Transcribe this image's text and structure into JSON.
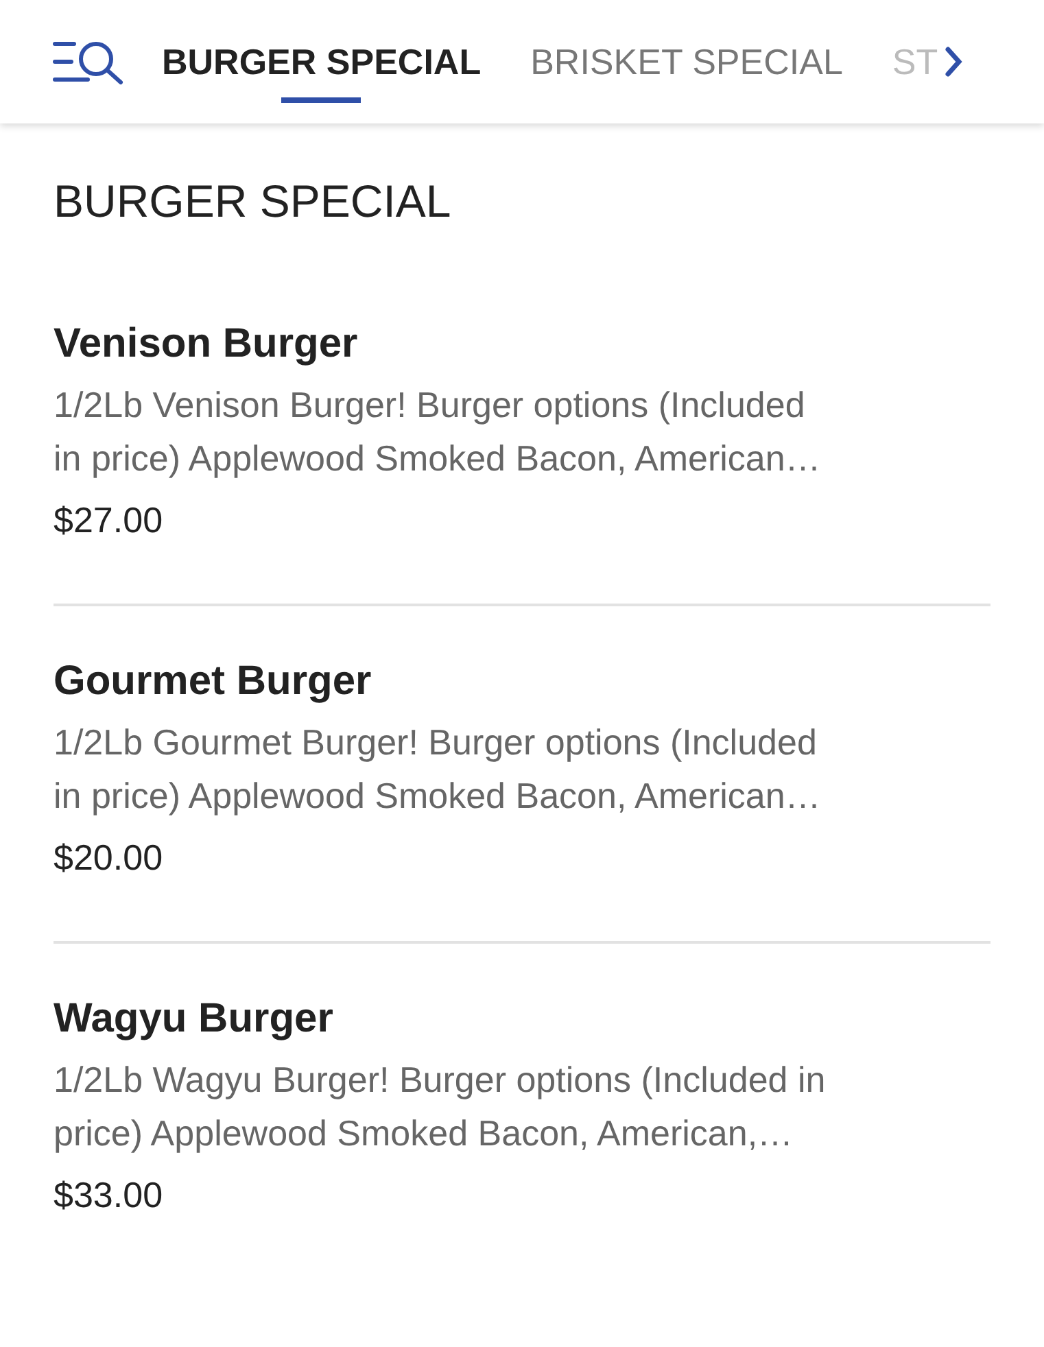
{
  "tabs": [
    {
      "label": "BURGER SPECIAL",
      "selected": true
    },
    {
      "label": "BRISKET SPECIAL",
      "selected": false
    },
    {
      "label": "ST",
      "selected": false
    }
  ],
  "section": {
    "title": "BURGER SPECIAL"
  },
  "items": [
    {
      "name": "Venison Burger",
      "description_lines": [
        "1/2Lb Venison Burger! Burger options (Included",
        "in price) Applewood Smoked Bacon, American…"
      ],
      "price": "$27.00"
    },
    {
      "name": "Gourmet Burger",
      "description_lines": [
        "1/2Lb Gourmet Burger! Burger options (Included",
        "in price) Applewood Smoked Bacon, American…"
      ],
      "price": "$20.00"
    },
    {
      "name": "Wagyu Burger",
      "description_lines": [
        "1/2Lb Wagyu Burger! Burger options (Included in",
        "price) Applewood Smoked Bacon, American,…"
      ],
      "price": "$33.00"
    }
  ]
}
